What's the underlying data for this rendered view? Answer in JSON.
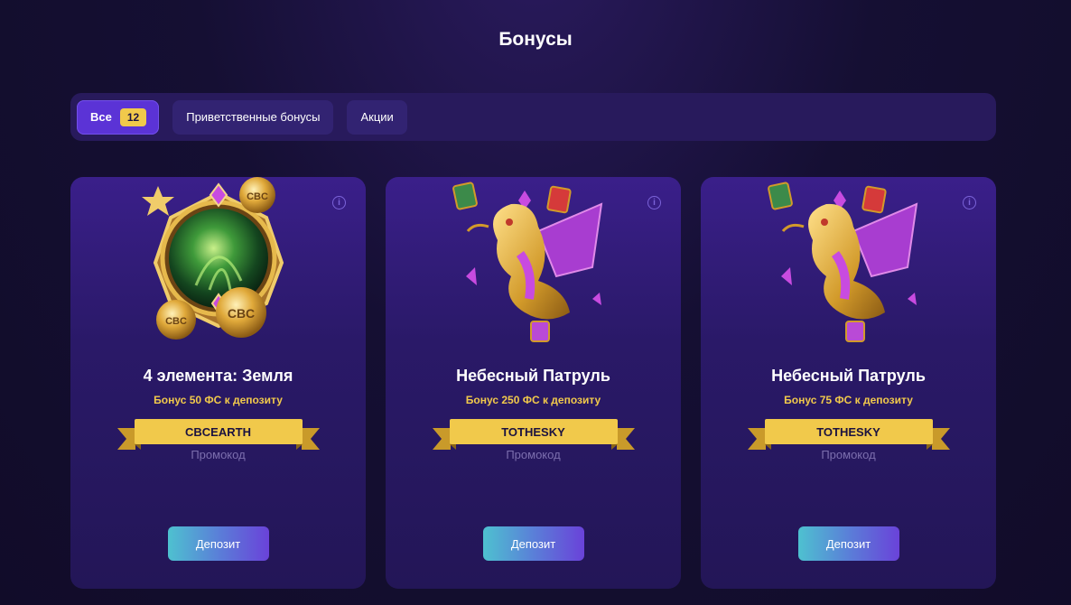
{
  "page": {
    "title": "Бонусы"
  },
  "filters": [
    {
      "label": "Все",
      "count": "12",
      "active": true
    },
    {
      "label": "Приветственные бонусы"
    },
    {
      "label": "Акции"
    }
  ],
  "cards": [
    {
      "title": "4 элемента: Земля",
      "subtitle": "Бонус 50 ФС к депозиту",
      "promo_code": "CBCEARTH",
      "promo_label": "Промокод",
      "button": "Депозит",
      "art_icon": "earth-orb-coins-icon"
    },
    {
      "title": "Небесный Патруль",
      "subtitle": "Бонус 250 ФС к депозиту",
      "promo_code": "TOTHESKY",
      "promo_label": "Промокод",
      "button": "Депозит",
      "art_icon": "golden-dragon-icon"
    },
    {
      "title": "Небесный Патруль",
      "subtitle": "Бонус 75 ФС к депозиту",
      "promo_code": "TOTHESKY",
      "promo_label": "Промокод",
      "button": "Депозит",
      "art_icon": "golden-dragon-icon"
    }
  ],
  "colors": {
    "accent_gold": "#f1c94b",
    "active_chip": "#5b33d6",
    "card_bg": "#2a1968",
    "button_gradient_start": "#4ec1d0",
    "button_gradient_end": "#6a42d9"
  }
}
